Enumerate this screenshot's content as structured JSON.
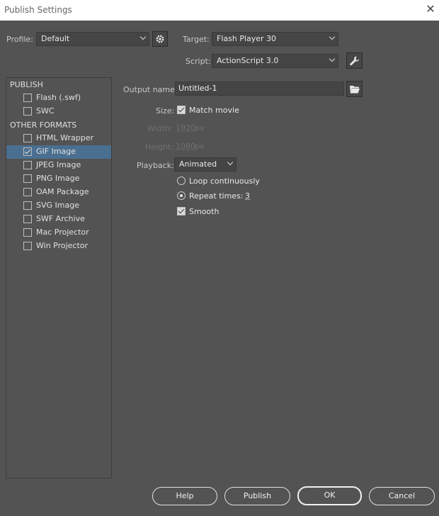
{
  "window": {
    "title": "Publish Settings",
    "close_glyph": "✕"
  },
  "profile": {
    "label": "Profile:",
    "value": "Default",
    "settings_icon": "gear-icon"
  },
  "target": {
    "label": "Target:",
    "value": "Flash Player 30"
  },
  "script": {
    "label": "Script:",
    "value": "ActionScript 3.0",
    "settings_icon": "wrench-icon"
  },
  "left_panel": {
    "publish_header": "PUBLISH",
    "publish_items": [
      {
        "label": "Flash (.swf)",
        "checked": false
      },
      {
        "label": "SWC",
        "checked": false
      }
    ],
    "other_header": "OTHER FORMATS",
    "other_items": [
      {
        "label": "HTML Wrapper",
        "checked": false
      },
      {
        "label": "GIF Image",
        "checked": true,
        "selected": true
      },
      {
        "label": "JPEG Image",
        "checked": false
      },
      {
        "label": "PNG Image",
        "checked": false
      },
      {
        "label": "OAM Package",
        "checked": false
      },
      {
        "label": "SVG Image",
        "checked": false
      },
      {
        "label": "SWF Archive",
        "checked": false
      },
      {
        "label": "Mac Projector",
        "checked": false
      },
      {
        "label": "Win Projector",
        "checked": false
      }
    ]
  },
  "gif": {
    "output_label": "Output name:",
    "output_value": "Untitled-1",
    "folder_icon": "folder-icon",
    "size_label": "Size:",
    "match_movie": "Match movie",
    "match_movie_checked": true,
    "width_label": "Width:",
    "width_value": "1920",
    "width_unit": "px",
    "height_label": "Height:",
    "height_value": "1080",
    "height_unit": "px",
    "playback_label": "Playback:",
    "playback_value": "Animated",
    "loop_label": "Loop continuously",
    "repeat_label": "Repeat times:",
    "repeat_value": "3",
    "smooth_label": "Smooth",
    "smooth_checked": true
  },
  "buttons": {
    "help": "Help",
    "publish": "Publish",
    "ok": "OK",
    "cancel": "Cancel"
  }
}
